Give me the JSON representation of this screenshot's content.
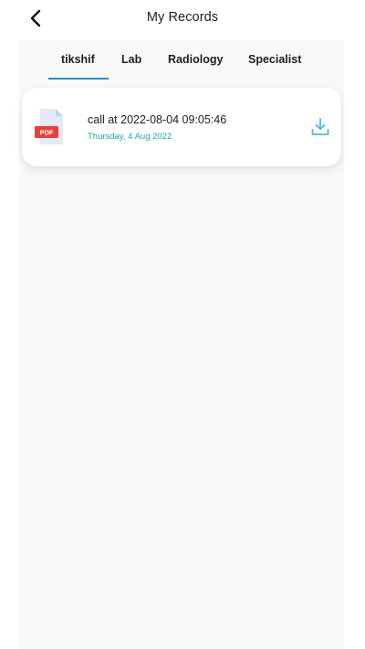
{
  "header": {
    "title": "My Records",
    "back_icon": "chevron-left-icon"
  },
  "tabs": [
    {
      "label": "tikshif",
      "active": true
    },
    {
      "label": "Lab",
      "active": false
    },
    {
      "label": "Radiology",
      "active": false
    },
    {
      "label": "Specialist",
      "active": false
    }
  ],
  "records": [
    {
      "title": "call at 2022-08-04 09:05:46",
      "date": "Thursday, 4 Aug 2022",
      "file_icon": "pdf-file-icon",
      "file_badge": "PDF",
      "action_icon": "download-icon"
    }
  ],
  "colors": {
    "accent_tab": "#2a8fd4",
    "date_text": "#1aa9a0",
    "download_icon": "#46c2c8",
    "pdf_red": "#e8413c"
  }
}
